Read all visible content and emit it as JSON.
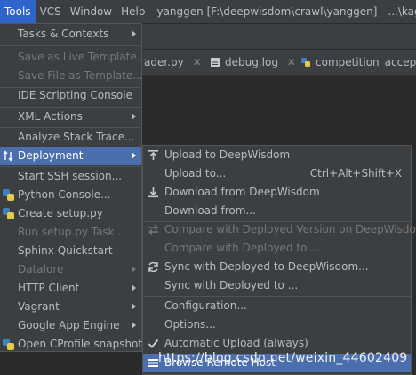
{
  "menubar": {
    "items": [
      "Tools",
      "VCS",
      "Window",
      "Help"
    ],
    "window_title": "yanggen [F:\\deepwisdom\\crawl\\yanggen] - ...\\kaggle_se"
  },
  "tabs": [
    {
      "label": "ader.py"
    },
    {
      "label": "debug.log"
    },
    {
      "label": "competition_acceptor"
    }
  ],
  "tools_menu": {
    "items": [
      {
        "label": "Tasks & Contexts",
        "has_submenu": true
      },
      {
        "label": "Save as Live Template...",
        "disabled": true
      },
      {
        "label": "Save File as Template...",
        "disabled": true
      },
      {
        "label": "IDE Scripting Console"
      },
      {
        "label": "XML Actions",
        "has_submenu": true
      },
      {
        "label": "Analyze Stack Trace..."
      },
      {
        "label": "Deployment",
        "has_submenu": true,
        "selected": true,
        "icon": "deployment-icon"
      },
      {
        "label": "Start SSH session..."
      },
      {
        "label": "Python Console...",
        "icon": "python-icon"
      },
      {
        "label": "Create setup.py",
        "icon": "python-icon"
      },
      {
        "label": "Run setup.py Task...",
        "disabled": true
      },
      {
        "label": "Sphinx Quickstart"
      },
      {
        "label": "Datalore",
        "disabled": true,
        "has_submenu": true
      },
      {
        "label": "HTTP Client",
        "has_submenu": true
      },
      {
        "label": "Vagrant",
        "has_submenu": true
      },
      {
        "label": "Google App Engine",
        "has_submenu": true
      },
      {
        "label": "Open CProfile snapshot",
        "icon": "cprofile-icon"
      }
    ]
  },
  "deployment_menu": {
    "items": [
      {
        "label": "Upload to DeepWisdom",
        "icon": "upload-icon"
      },
      {
        "label": "Upload to...",
        "shortcut": "Ctrl+Alt+Shift+X"
      },
      {
        "label": "Download from DeepWisdom",
        "icon": "download-icon"
      },
      {
        "label": "Download from..."
      },
      {
        "label": "Compare with Deployed Version on DeepWisdom",
        "disabled": true,
        "icon": "compare-icon"
      },
      {
        "label": "Compare with Deployed to ...",
        "disabled": true
      },
      {
        "label": "Sync with Deployed to DeepWisdom...",
        "icon": "sync-icon"
      },
      {
        "label": "Sync with Deployed to ..."
      },
      {
        "label": "Configuration..."
      },
      {
        "label": "Options..."
      },
      {
        "label": "Automatic Upload (always)",
        "checked": true
      },
      {
        "label": "Browse Remote Host",
        "selected": true,
        "icon": "browse-remote-host-icon"
      }
    ]
  },
  "watermark": "https://blog.csdn.net/weixin_44602409",
  "colors": {
    "menu_bg": "#3c3f41",
    "selection": "#4b6eaf",
    "text": "#bbbbbb",
    "disabled_text": "#777777",
    "editor_bg": "#2b2b2b"
  }
}
